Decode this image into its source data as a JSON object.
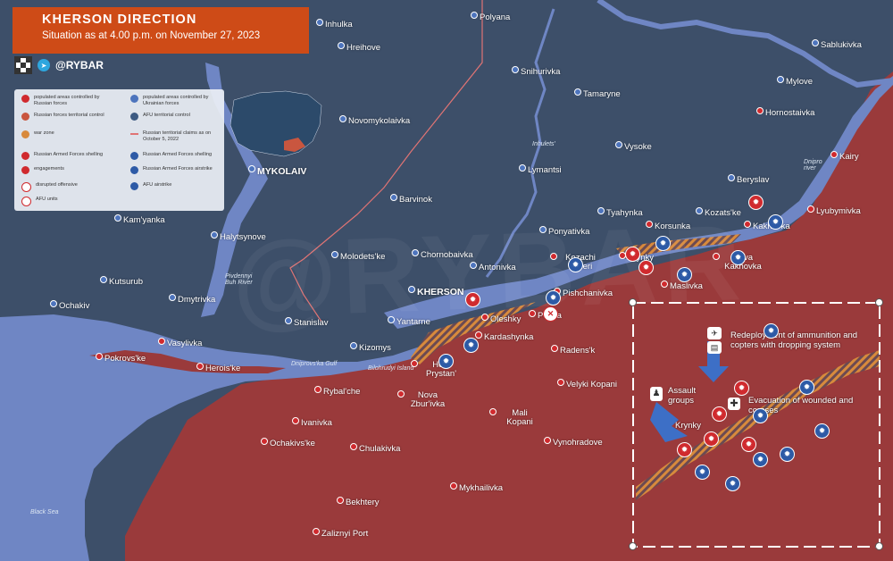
{
  "header": {
    "title": "KHERSON DIRECTION",
    "subtitle": "Situation as at 4.00 p.m. on November 27, 2023"
  },
  "brand": {
    "handle": "@RYBAR",
    "telegram_icon": "telegram-icon",
    "qr_icon": "qr-code-icon"
  },
  "watermark": "@RYBAR",
  "colors": {
    "russian_control": "#9a3a3b",
    "ukrainian_control": "#3d4f69",
    "water": "#6f86c4",
    "war_zone": "#d88a3c",
    "accent": "#ce4b17"
  },
  "legend": {
    "items": [
      {
        "icon": "red-dot",
        "text": "populated areas controlled by Russian forces"
      },
      {
        "icon": "blue-dot",
        "text": "populated areas controlled by Ukrainian forces"
      },
      {
        "icon": "red-hex",
        "text": "Russian forces territorial control"
      },
      {
        "icon": "blue-hex",
        "text": "AFU territorial control"
      },
      {
        "icon": "hatch",
        "text": "war zone"
      },
      {
        "icon": "red-line",
        "text": "Russian territorial claims as on October 5, 2022"
      },
      {
        "icon": "red-shelling",
        "text": "Russian Armed Forces shelling"
      },
      {
        "icon": "blue-shelling",
        "text": "Russian Armed Forces shelling"
      },
      {
        "icon": "red-engagement",
        "text": "engagements"
      },
      {
        "icon": "blue-airstrike",
        "text": "Russian Armed Forces airstrike"
      },
      {
        "icon": "disrupted",
        "text": "disrupted offensive"
      },
      {
        "icon": "afu-airstrike",
        "text": "AFU airstrike"
      },
      {
        "icon": "afu-units",
        "text": "AFU units"
      }
    ]
  },
  "cities": [
    {
      "name": "Inhulka",
      "side": "ua"
    },
    {
      "name": "Polyana",
      "side": "ua"
    },
    {
      "name": "Sablukivka",
      "side": "ua"
    },
    {
      "name": "Hreihove",
      "side": "ua"
    },
    {
      "name": "Snihurivka",
      "side": "ua"
    },
    {
      "name": "Mylove",
      "side": "ua"
    },
    {
      "name": "Tamaryne",
      "side": "ua"
    },
    {
      "name": "Hornostaivka",
      "side": "ru"
    },
    {
      "name": "Novomykolaivka",
      "side": "ua"
    },
    {
      "name": "Vysoke",
      "side": "ua"
    },
    {
      "name": "Kairy",
      "side": "ru"
    },
    {
      "name": "MYKOLAIV",
      "side": "ua"
    },
    {
      "name": "Lymantsi",
      "side": "ua"
    },
    {
      "name": "Beryslav",
      "side": "ua"
    },
    {
      "name": "Barvinok",
      "side": "ua"
    },
    {
      "name": "Tyahynka",
      "side": "ua"
    },
    {
      "name": "Kozats'ke",
      "side": "ua"
    },
    {
      "name": "Lyubymivka",
      "side": "ru"
    },
    {
      "name": "Kam'yanka",
      "side": "ua"
    },
    {
      "name": "Korsunka",
      "side": "ru"
    },
    {
      "name": "Kakhovka",
      "side": "ru"
    },
    {
      "name": "Halytsynove",
      "side": "ua"
    },
    {
      "name": "Ponyativka",
      "side": "ua"
    },
    {
      "name": "Molodets'ke",
      "side": "ua"
    },
    {
      "name": "Chornobaivka",
      "side": "ua"
    },
    {
      "name": "Kozachi Laheri",
      "side": "ru"
    },
    {
      "name": "Krynky",
      "side": "ru"
    },
    {
      "name": "Nova Kakhovka",
      "side": "ru"
    },
    {
      "name": "Antonivka",
      "side": "ua"
    },
    {
      "name": "Kutsurub",
      "side": "ua"
    },
    {
      "name": "KHERSON",
      "side": "ua"
    },
    {
      "name": "Maslivka",
      "side": "ru"
    },
    {
      "name": "Pishchanivka",
      "side": "ru"
    },
    {
      "name": "Dmytrivka",
      "side": "ua"
    },
    {
      "name": "Ochakiv",
      "side": "ua"
    },
    {
      "name": "Oleshky",
      "side": "ru"
    },
    {
      "name": "Poima",
      "side": "ru"
    },
    {
      "name": "Stanislav",
      "side": "ua"
    },
    {
      "name": "Yantarne",
      "side": "ua"
    },
    {
      "name": "Vasylivka",
      "side": "ru"
    },
    {
      "name": "Kizomys",
      "side": "ua"
    },
    {
      "name": "Kardashynka",
      "side": "ru"
    },
    {
      "name": "Radens'k",
      "side": "ru"
    },
    {
      "name": "Pokrovs'ke",
      "side": "ru"
    },
    {
      "name": "Herois'ke",
      "side": "ru"
    },
    {
      "name": "Hola Prystan'",
      "side": "ru"
    },
    {
      "name": "Velyki Kopani",
      "side": "ru"
    },
    {
      "name": "Rybal'che",
      "side": "ru"
    },
    {
      "name": "Nova Zbur'ivka",
      "side": "ru"
    },
    {
      "name": "Mali Kopani",
      "side": "ru"
    },
    {
      "name": "Ivanivka",
      "side": "ru"
    },
    {
      "name": "Ochakivs'ke",
      "side": "ru"
    },
    {
      "name": "Chulakivka",
      "side": "ru"
    },
    {
      "name": "Vynohradove",
      "side": "ru"
    },
    {
      "name": "Mykhailivka",
      "side": "ru"
    },
    {
      "name": "Bekhtery",
      "side": "ru"
    },
    {
      "name": "Zaliznyi Port",
      "side": "ru"
    }
  ],
  "water_labels": {
    "inhulets": "Inhulets'",
    "dnipro": "Dnipro river",
    "pivdennyi_buh": "Pivdennyi Buh River",
    "dniprovska_gulf": "Dniprovs'ka Gulf",
    "bilohrudyi": "Bilohrudyi Island",
    "black_sea": "Black Sea"
  },
  "inset": {
    "title_krynky": "Krynky",
    "redeployment": "Redeployment of ammunition and copters with dropping system",
    "assault": "Assault groups",
    "evacuation": "Evacuation of wounded and corpses"
  }
}
